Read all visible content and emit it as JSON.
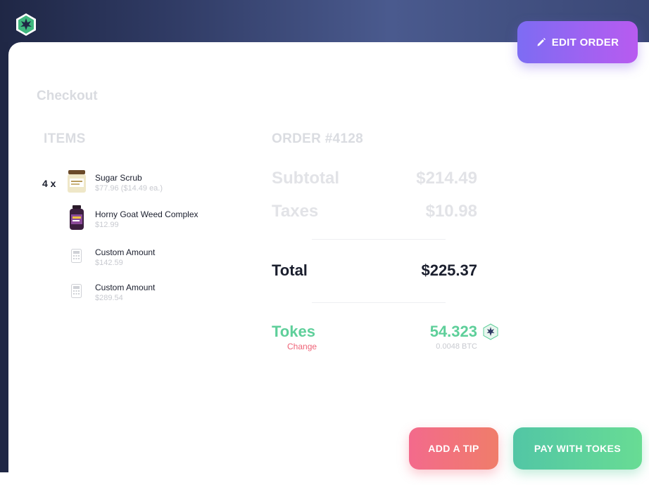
{
  "header": {
    "logo_icon": "cannabis-hex-logo",
    "edit_order_label": "EDIT ORDER",
    "edit_icon": "pencil-icon"
  },
  "page": {
    "title": "Checkout"
  },
  "items_section": {
    "heading": "ITEMS",
    "items": [
      {
        "qty": "4 x",
        "name": "Sugar Scrub",
        "price": "$77.96 ($14.49 ea.)",
        "icon": "jar-thumbnail"
      },
      {
        "qty": "",
        "name": "Horny Goat Weed Complex",
        "price": "$12.99",
        "icon": "bottle-thumbnail"
      },
      {
        "qty": "",
        "name": "Custom Amount",
        "price": "$142.59",
        "icon": "calculator-icon"
      },
      {
        "qty": "",
        "name": "Custom Amount",
        "price": "$289.54",
        "icon": "calculator-icon"
      }
    ]
  },
  "order": {
    "heading": "ORDER #4128",
    "subtotal_label": "Subtotal",
    "subtotal_value": "$214.49",
    "taxes_label": "Taxes",
    "taxes_value": "$10.98",
    "total_label": "Total",
    "total_value": "$225.37",
    "tokes_label": "Tokes",
    "change_label": "Change",
    "tokes_value": "54.323",
    "btc_value": "0.0048 BTC",
    "token_icon": "toke-coin-icon"
  },
  "actions": {
    "tip_label": "ADD A TIP",
    "pay_label": "PAY WITH TOKES"
  },
  "colors": {
    "accent_purple": "#9a63f2",
    "tokes_green": "#5ecf9a",
    "change_red": "#ef6478",
    "header_navy": "#2f3a63"
  }
}
